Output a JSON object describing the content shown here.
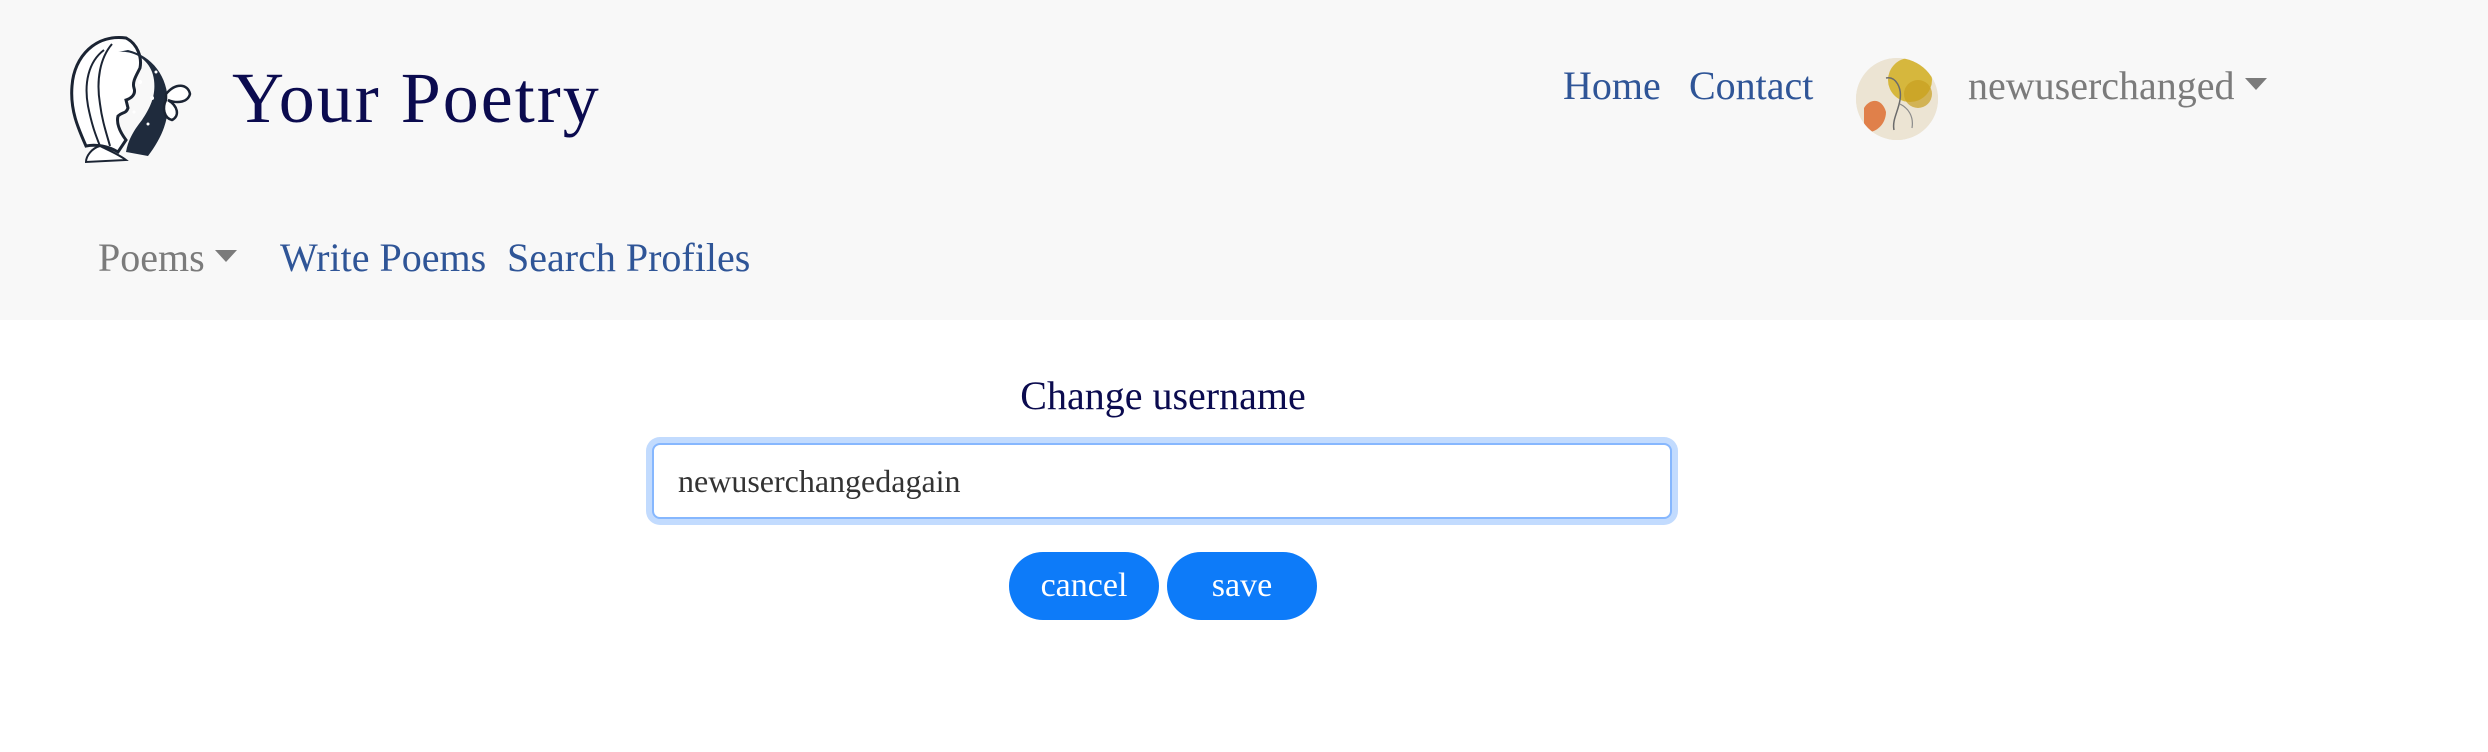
{
  "header": {
    "brand_title": "Your Poetry",
    "nav": {
      "home": "Home",
      "contact": "Contact",
      "user": "newuserchanged"
    },
    "secondary_nav": {
      "poems": "Poems",
      "write_poems": "Write Poems",
      "search_profiles": "Search Profiles"
    }
  },
  "form": {
    "title": "Change username",
    "username_value": "newuserchangedagain",
    "cancel_label": "cancel",
    "save_label": "save"
  },
  "colors": {
    "brand": "#0b0b4f",
    "link": "#2f5597",
    "button": "#0d7bf9",
    "navbar_bg": "#f8f8f8"
  },
  "icons": {
    "logo": "woman-profile-logo-icon",
    "avatar": "user-avatar",
    "dropdown": "caret-down-icon"
  }
}
